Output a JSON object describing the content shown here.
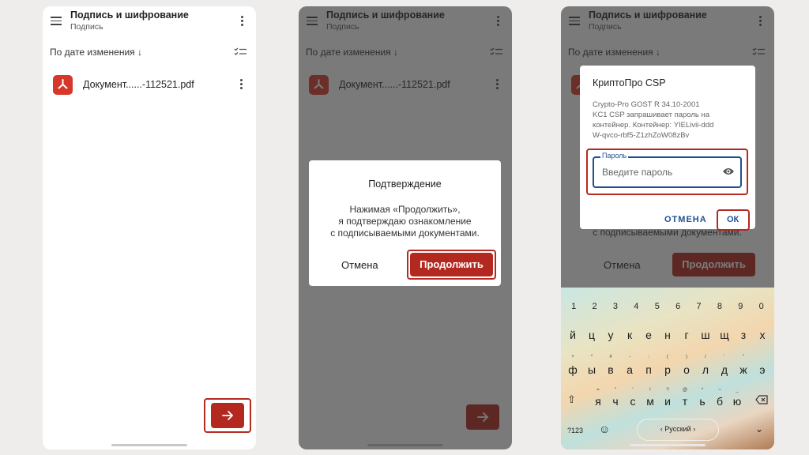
{
  "app": {
    "title": "Подпись и шифрование",
    "subtitle": "Подпись",
    "sort_label": "По дате изменения ↓",
    "file_name": "Документ......-112521.pdf"
  },
  "confirm_dialog": {
    "title": "Подтверждение",
    "text_line1": "Нажимая «Продолжить»,",
    "text_line2": "я подтверждаю ознакомление",
    "text_line3": "с подписываемыми документами.",
    "cancel_label": "Отмена",
    "continue_label": "Продолжить"
  },
  "csp_dialog": {
    "title": "КриптоПро CSP",
    "text_line1": "Crypto-Pro GOST R 34.10-2001",
    "text_line2": "KC1 CSP запрашивает пароль на",
    "text_line3": "контейнер. Контейнер: YIELivii-ddd",
    "text_line4": "W-qvco-rbf5-Z1zhZoW08zBv",
    "password_label": "Пароль",
    "password_placeholder": "Введите пароль",
    "cancel_label": "ОТМЕНА",
    "ok_label": "ОК"
  },
  "keyboard": {
    "numbers": [
      "1",
      "2",
      "3",
      "4",
      "5",
      "6",
      "7",
      "8",
      "9",
      "0"
    ],
    "row1": [
      "й",
      "ц",
      "у",
      "к",
      "е",
      "н",
      "г",
      "ш",
      "щ",
      "з",
      "х"
    ],
    "row2": [
      "ф",
      "ы",
      "в",
      "а",
      "п",
      "р",
      "о",
      "л",
      "д",
      "ж",
      "э"
    ],
    "row2_sub": [
      "+",
      "*",
      "#",
      "-",
      ":",
      "(",
      ")",
      "/",
      "'",
      "\"",
      " "
    ],
    "row3": [
      "я",
      "ч",
      "с",
      "м",
      "и",
      "т",
      "ь",
      "б",
      "ю"
    ],
    "row3_sub": [
      "=",
      "\"",
      "'",
      "!",
      "?",
      "@",
      "*",
      "~",
      "_"
    ],
    "symbols_label": "?123",
    "language_label": "‹ Русский ›"
  },
  "colors": {
    "accent_red": "#b4291f",
    "highlight": "#b52a20",
    "csp_blue": "#1d4f91"
  }
}
